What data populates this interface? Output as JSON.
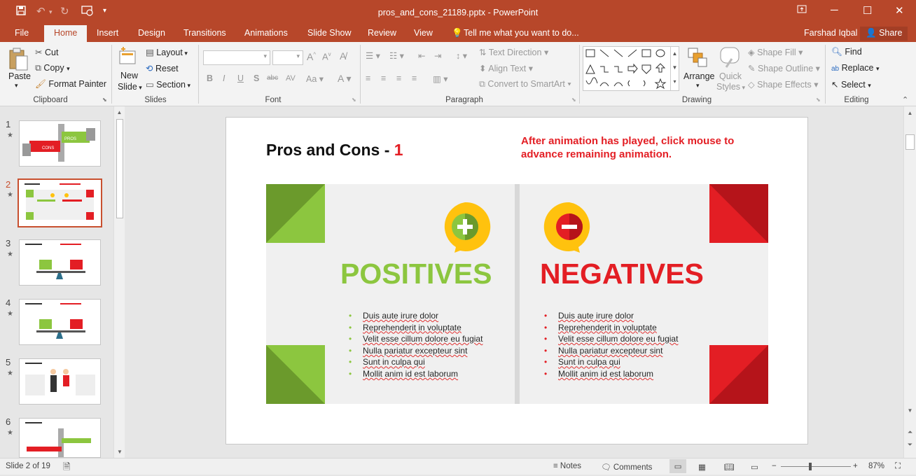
{
  "window": {
    "title": "pros_and_cons_21189.pptx - PowerPoint",
    "user": "Farshad Iqbal",
    "share": "Share"
  },
  "tabs": [
    "File",
    "Home",
    "Insert",
    "Design",
    "Transitions",
    "Animations",
    "Slide Show",
    "Review",
    "View"
  ],
  "tell_me": "Tell me what you want to do...",
  "ribbon": {
    "clipboard": {
      "paste": "Paste",
      "cut": "Cut",
      "copy": "Copy",
      "format_painter": "Format Painter",
      "group": "Clipboard"
    },
    "slides": {
      "new_slide_1": "New",
      "new_slide_2": "Slide",
      "layout": "Layout",
      "reset": "Reset",
      "section": "Section",
      "group": "Slides"
    },
    "font": {
      "group": "Font"
    },
    "paragraph": {
      "text_direction": "Text Direction",
      "align_text": "Align Text",
      "smartart": "Convert to SmartArt",
      "group": "Paragraph"
    },
    "drawing": {
      "arrange": "Arrange",
      "quick_styles_1": "Quick",
      "quick_styles_2": "Styles",
      "shape_fill": "Shape Fill",
      "shape_outline": "Shape Outline",
      "shape_effects": "Shape Effects",
      "group": "Drawing"
    },
    "editing": {
      "find": "Find",
      "replace": "Replace",
      "select": "Select",
      "group": "Editing"
    }
  },
  "thumbnails": [
    {
      "num": "1",
      "star": "★"
    },
    {
      "num": "2",
      "star": "★"
    },
    {
      "num": "3",
      "star": "★"
    },
    {
      "num": "4",
      "star": "★"
    },
    {
      "num": "5",
      "star": "★"
    },
    {
      "num": "6",
      "star": "★"
    }
  ],
  "slide": {
    "title": "Pros and Cons - ",
    "title_num": "1",
    "note": "After animation has played, click mouse to advance remaining animation.",
    "positives": "POSITIVES",
    "negatives": "NEGATIVES",
    "bullets_pos": [
      "Duis aute irure dolor",
      "Reprehenderit in voluptate",
      "Velit esse cillum dolore eu fugiat",
      "Nulla pariatur excepteur sint",
      "Sunt in culpa qui",
      "Mollit anim id est laborum"
    ],
    "bullets_neg": [
      "Duis aute irure dolor",
      "Reprehenderit in voluptate",
      "Velit esse cillum dolore eu fugiat",
      "Nulla pariatur excepteur sint",
      "Sunt in culpa qui",
      "Mollit anim id est laborum"
    ],
    "colors": {
      "green": "#8cc63f",
      "dark_green": "#6b9a2c",
      "red": "#e31e24",
      "dark_red": "#b5141a",
      "yellow": "#ffc20e"
    }
  },
  "status": {
    "slide_info": "Slide 2 of 19",
    "notes": "Notes",
    "comments": "Comments",
    "zoom": "87%"
  }
}
